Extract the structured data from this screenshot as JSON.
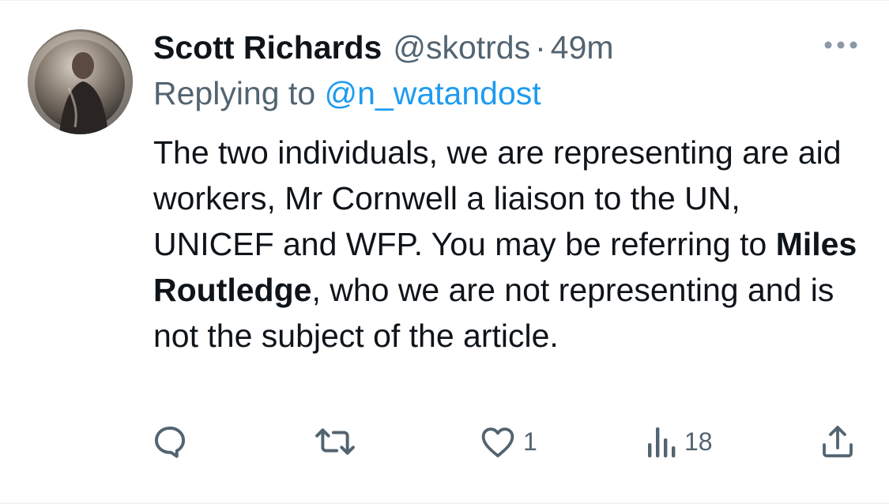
{
  "tweet": {
    "author": {
      "display_name": "Scott Richards",
      "handle": "@skotrds",
      "separator": "·",
      "time": "49m"
    },
    "replying_prefix": "Replying to ",
    "replying_handle": "@n_watandost",
    "text": {
      "part1": "The two individuals, we are representing are aid workers, Mr Cornwell a liaison to the UN, UNICEF and WFP. You may be referring to ",
      "bold": "Miles Routledge",
      "part2": ", who we are not representing and is not the subject of the article."
    },
    "actions": {
      "reply": {
        "icon": "reply-icon",
        "count": ""
      },
      "retweet": {
        "icon": "retweet-icon",
        "count": ""
      },
      "like": {
        "icon": "heart-icon",
        "count": "1"
      },
      "views": {
        "icon": "views-icon",
        "count": "18"
      },
      "share": {
        "icon": "share-icon",
        "count": ""
      }
    },
    "colors": {
      "text": "#0f1419",
      "secondary": "#536471",
      "link": "#1d9bf0"
    }
  }
}
